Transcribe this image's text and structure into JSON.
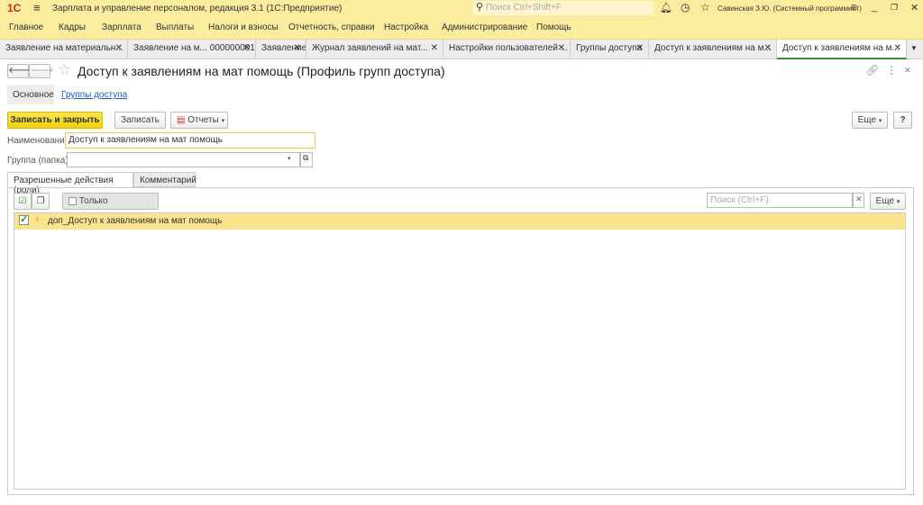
{
  "app": {
    "title": "Зарплата и управление персоналом, редакция 3.1  (1С:Предприятие)",
    "search_placeholder": "Поиск Ctrl+Shift+F",
    "user": "Савинская З.Ю. (Системный программист)",
    "logo": "1С"
  },
  "menu": [
    "Главное",
    "Кадры",
    "Зарплата",
    "Выплаты",
    "Налоги и взносы",
    "Отчетность, справки",
    "Настройка",
    "Администрирование",
    "Помощь"
  ],
  "tabs": [
    {
      "label": "Заявление на материальн..."
    },
    {
      "label": "Заявление на м... 000000001"
    },
    {
      "label": "Заявление"
    },
    {
      "label": "Журнал заявлений на мат..."
    },
    {
      "label": "Настройки пользователей ..."
    },
    {
      "label": "Группы доступа"
    },
    {
      "label": "Доступ к заявлениям на м..."
    },
    {
      "label": "Доступ к заявлениям на м...",
      "active": true
    }
  ],
  "form": {
    "title": "Доступ к заявлениям на мат помощь (Профиль групп доступа)",
    "nav": {
      "main": "Основное",
      "groups": "Группы доступа"
    },
    "toolbar": {
      "save_close": "Записать и закрыть",
      "save": "Записать",
      "reports": "Отчеты",
      "more": "Еще",
      "help": "?"
    },
    "name_label": "Наименование:",
    "name_value": "Доступ к заявлениям на мат помощь",
    "group_label": "Группа (папка):",
    "group_value": "",
    "subtabs": [
      "Разрешенные действия (роли)",
      "Комментарий"
    ],
    "only_selected": "Только выбранные",
    "search_placeholder": "Поиск (Ctrl+F)",
    "more": "Еще",
    "roles": [
      {
        "name": "доп_Доступ к заявлениям на мат помощь",
        "checked": true
      }
    ]
  }
}
